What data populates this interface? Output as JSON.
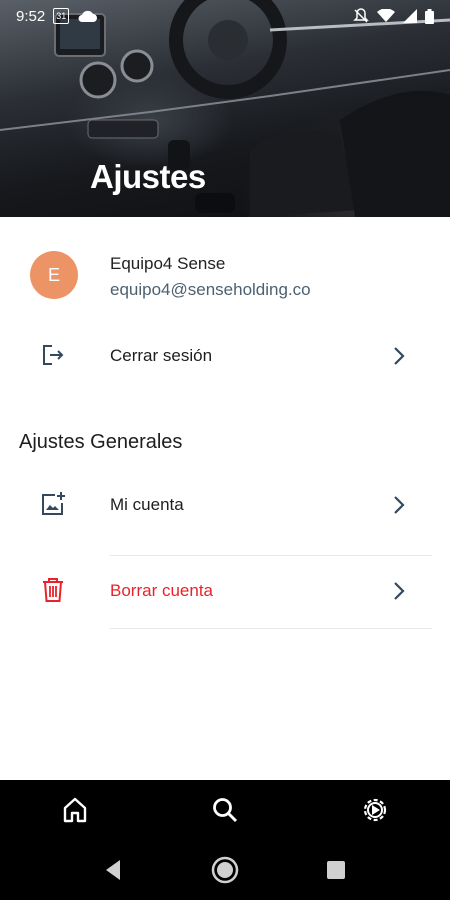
{
  "status_bar": {
    "time": "9:52",
    "calendar_day": "31"
  },
  "header": {
    "title": "Ajustes"
  },
  "profile": {
    "avatar_initial": "E",
    "name": "Equipo4 Sense",
    "email": "equipo4@senseholding.co"
  },
  "logout": {
    "label": "Cerrar sesión"
  },
  "general_settings": {
    "title": "Ajustes Generales",
    "items": [
      {
        "label": "Mi cuenta",
        "icon": "add-photo-icon"
      },
      {
        "label": "Borrar cuenta",
        "icon": "trash-icon",
        "color": "#e8232b"
      }
    ]
  },
  "bottom_nav": {
    "items": [
      "home-icon",
      "search-icon",
      "settings-icon"
    ]
  },
  "colors": {
    "accent_blue": "#34495e",
    "danger": "#e8232b",
    "avatar": "#ec9466"
  }
}
